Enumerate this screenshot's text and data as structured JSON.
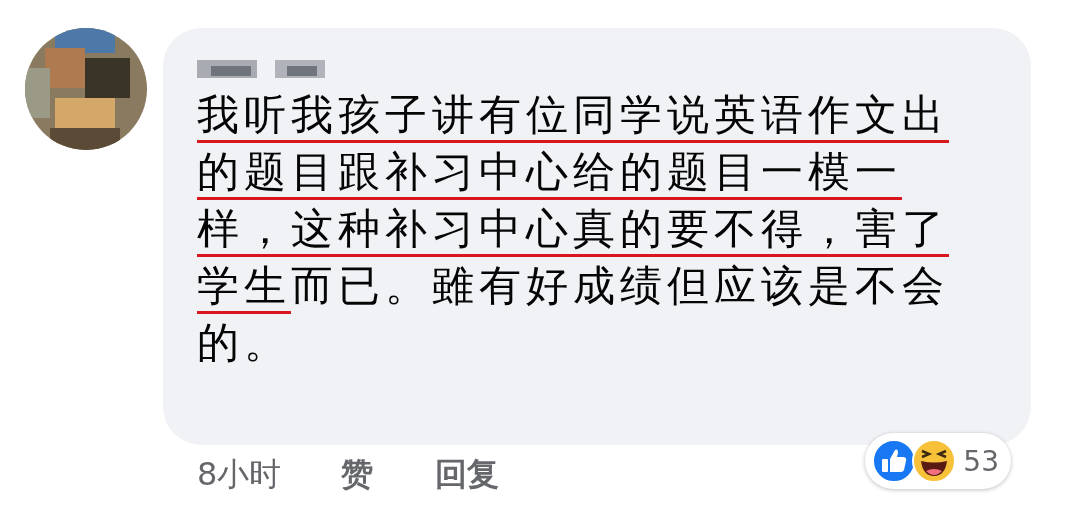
{
  "comment": {
    "segments": [
      {
        "text": "我听我孩子讲有位同学说英语作文出的题目跟补习中心给的题目一模一样，这种补习中心真的要不得，害了学生",
        "underlined": true
      },
      {
        "text": "而已。雖有好成绩但应该是不会的。",
        "underlined": false
      }
    ]
  },
  "actions": [
    {
      "label": "8小时",
      "kind": "time"
    },
    {
      "label": "赞",
      "kind": "link"
    },
    {
      "label": "回复",
      "kind": "link"
    }
  ],
  "reactions": {
    "count": "53"
  }
}
